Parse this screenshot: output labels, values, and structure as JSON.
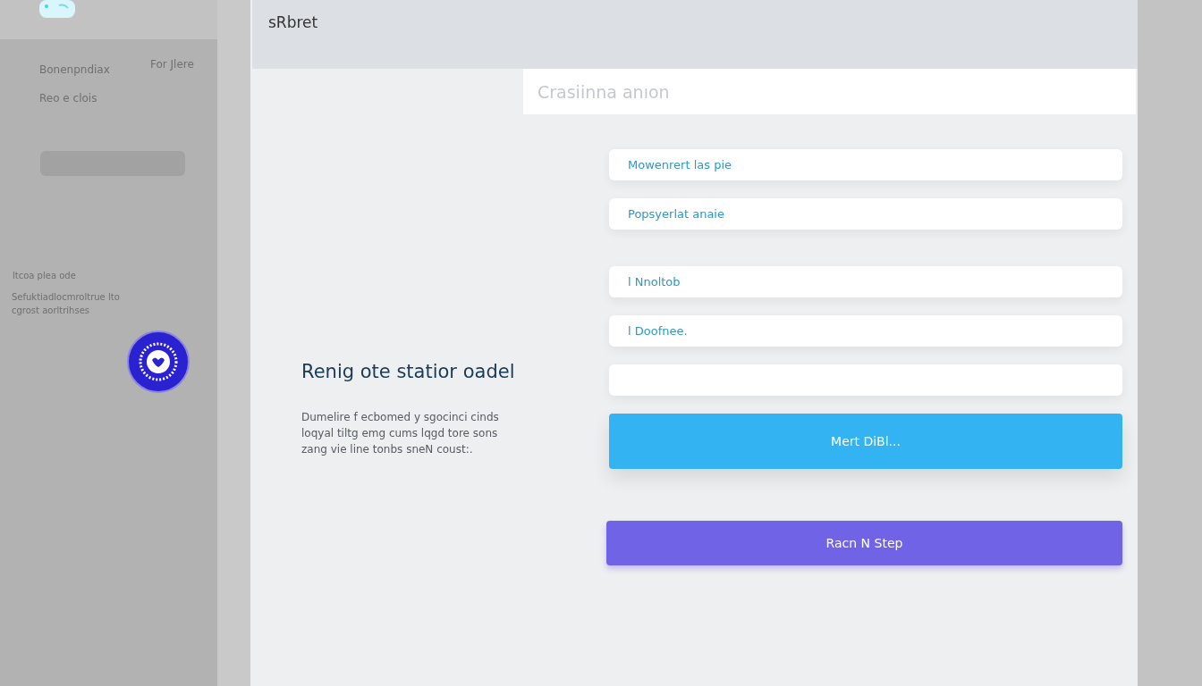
{
  "sidebar": {
    "links": [
      {
        "label": "Bonenpndiax"
      },
      {
        "label": "For Jlere"
      },
      {
        "label": "Reo e clois"
      }
    ],
    "section_title": "ltcoa plea ode",
    "section_text": "Sefuktiadlocmroltrue lto cgrost aorltrihses"
  },
  "header": {
    "title": "sRbret"
  },
  "search": {
    "placeholder": "Crasiinna anıon"
  },
  "intro": {
    "title": "Renig ote statior oadel",
    "text": "Dumelire f ecbomed y sgocinci cinds loqyal tiltg emg cums lqgd tore sons zang vie line tonbs sneN coust:."
  },
  "fields": [
    {
      "kind": "text",
      "value": "Mowenrert las pie"
    },
    {
      "kind": "text",
      "value": "Popsyerlat anaie"
    },
    {
      "kind": "text",
      "value": "l Nnoltob"
    },
    {
      "kind": "text",
      "value": "l Doofnee."
    },
    {
      "kind": "text"
    }
  ],
  "buttons": [
    {
      "kind": "primary",
      "label": "Mert DiBl..."
    },
    {
      "kind": "secondary",
      "label": "Racn N Step"
    }
  ]
}
